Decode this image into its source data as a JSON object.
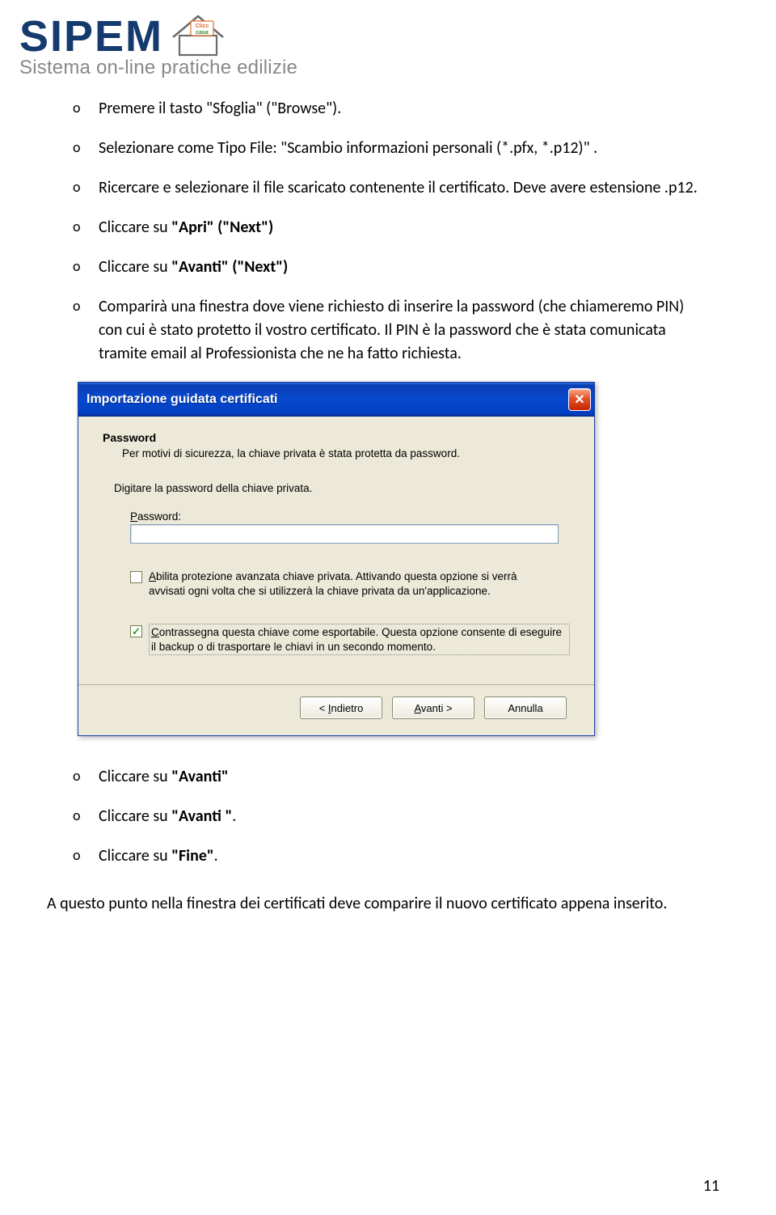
{
  "logo": {
    "brand": "SIPEM",
    "badge_line1": "Clicc",
    "badge_line2": "casa",
    "tagline": "Sistema on-line pratiche edilizie"
  },
  "bullets_top": [
    {
      "o": "o",
      "text": "Premere il tasto \"Sfoglia\" (\"Browse\")."
    },
    {
      "o": "o",
      "text": "Selezionare come Tipo File: \"Scambio informazioni personali (*.pfx, *.p12)\" ."
    },
    {
      "o": "o",
      "text": "Ricercare e selezionare il file scaricato contenente il certificato. Deve avere estensione .p12."
    },
    {
      "o": "o",
      "text_pre": "Cliccare su ",
      "bold": "\"Apri\" (\"Next\")"
    },
    {
      "o": "o",
      "text_pre": "Cliccare su ",
      "bold": "\"Avanti\" (\"Next\")"
    },
    {
      "o": "o",
      "text": "Comparirà una finestra dove viene richiesto di inserire la password (che chiameremo PIN) con cui è stato protetto il vostro certificato. Il PIN è la password che è stata comunicata tramite email al Professionista che ne ha fatto richiesta."
    }
  ],
  "dialog": {
    "title": "Importazione guidata certificati",
    "heading": "Password",
    "subheading": "Per motivi di sicurezza, la chiave privata è stata protetta da password.",
    "instruction": "Digitare la password della chiave privata.",
    "password_label": "Password:",
    "checkbox1": "Abilita protezione avanzata chiave privata. Attivando questa opzione si verrà avvisati ogni volta che si utilizzerà la chiave privata da un'applicazione.",
    "checkbox2": "Contrassegna questa chiave come esportabile. Questa opzione consente di eseguire il backup o di trasportare le chiavi in un secondo momento.",
    "btn_back": "< Indietro",
    "btn_next": "Avanti >",
    "btn_cancel": "Annulla"
  },
  "bullets_bottom": [
    {
      "o": "o",
      "text_pre": "Cliccare su ",
      "bold": "\"Avanti\""
    },
    {
      "o": "o",
      "text_pre": "Cliccare su ",
      "bold": "\"Avanti \"",
      "tail": "."
    },
    {
      "o": "o",
      "text_pre": "Cliccare su ",
      "bold": "\"Fine\"",
      "tail": "."
    }
  ],
  "final": "A questo punto nella finestra dei certificati deve comparire il nuovo certificato appena inserito.",
  "page_number": "11"
}
